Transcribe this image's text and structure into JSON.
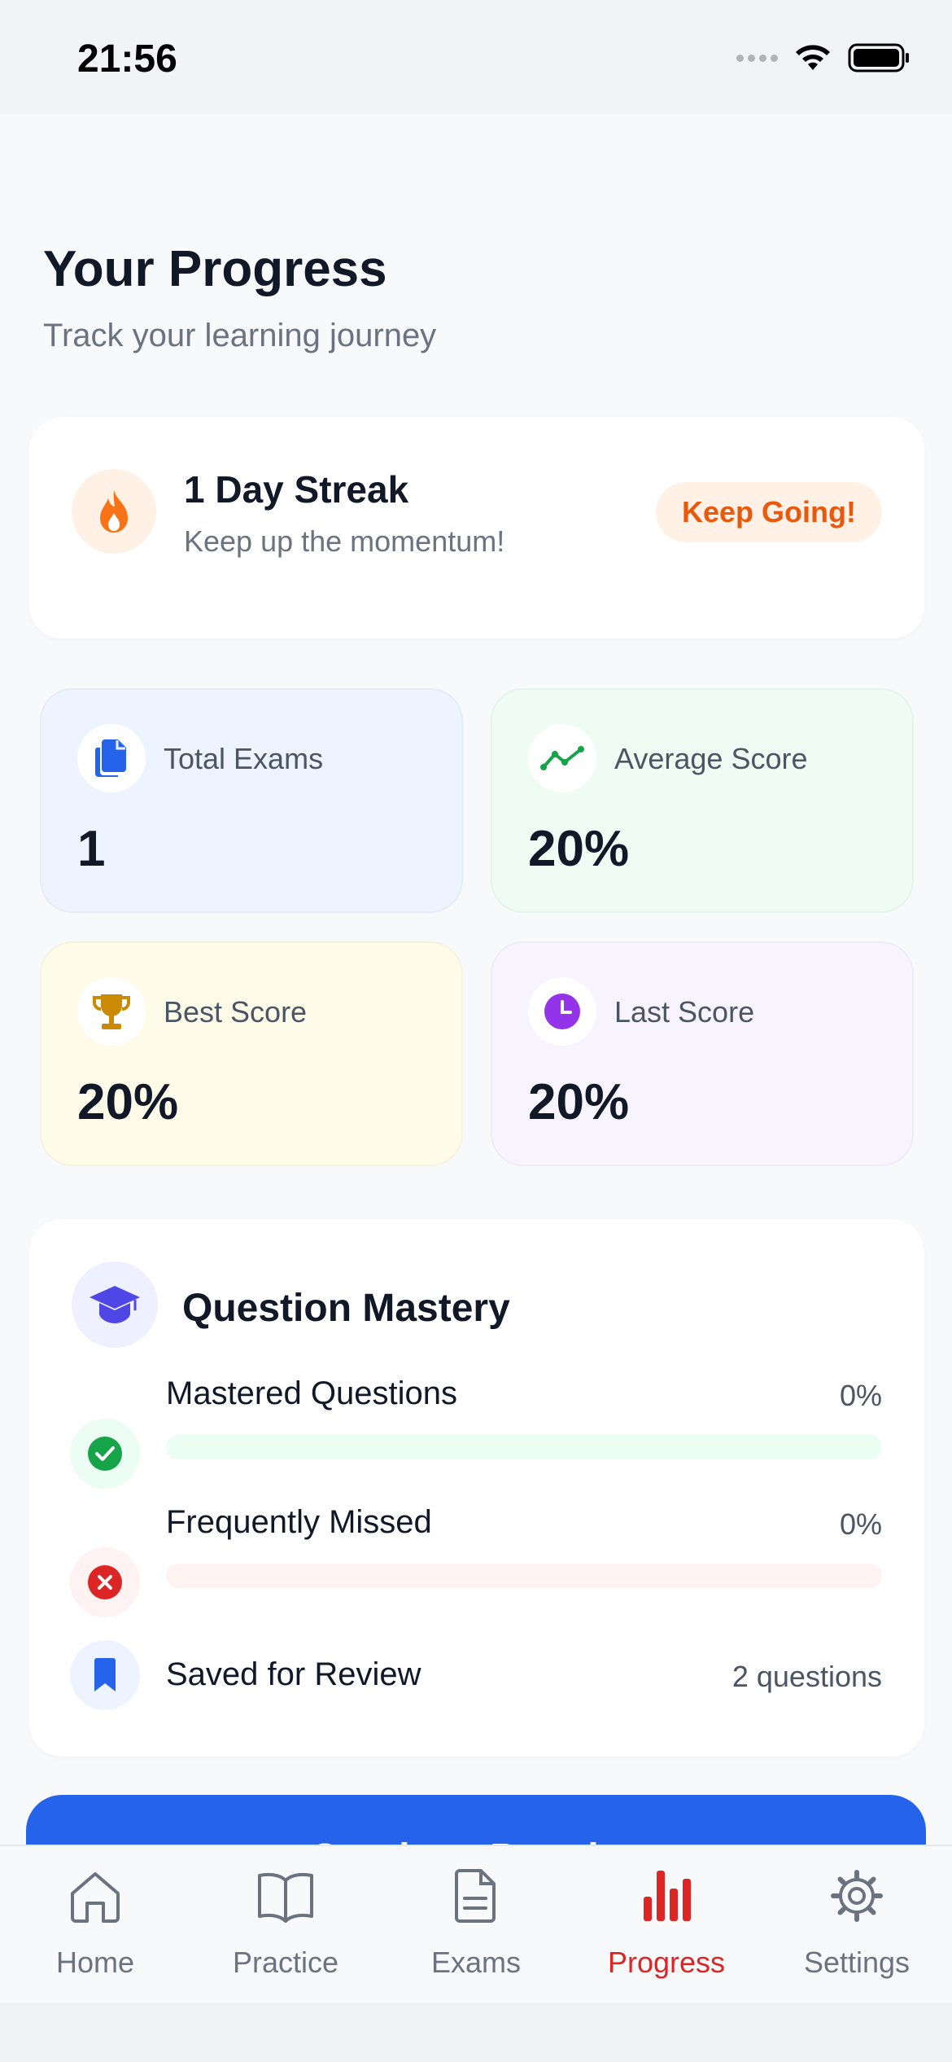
{
  "status_bar": {
    "time": "21:56"
  },
  "header": {
    "title": "Your Progress",
    "subtitle": "Track your learning journey"
  },
  "streak": {
    "icon": "flame-icon",
    "title": "1 Day Streak",
    "subtitle": "Keep up the momentum!",
    "badge": "Keep Going!"
  },
  "stats": {
    "total_exams": {
      "label": "Total Exams",
      "value": "1",
      "icon": "documents-icon"
    },
    "average_score": {
      "label": "Average Score",
      "value": "20%",
      "icon": "trend-icon"
    },
    "best_score": {
      "label": "Best Score",
      "value": "20%",
      "icon": "trophy-icon"
    },
    "last_score": {
      "label": "Last Score",
      "value": "20%",
      "icon": "clock-icon"
    }
  },
  "mastery": {
    "title": "Question Mastery",
    "mastered": {
      "label": "Mastered Questions",
      "value": "0%",
      "progress": 0
    },
    "missed": {
      "label": "Frequently Missed",
      "value": "0%",
      "progress": 0
    },
    "saved": {
      "label": "Saved for Review",
      "value": "2 questions"
    }
  },
  "cta": {
    "label": "Continue Practice"
  },
  "tabs": [
    {
      "label": "Home",
      "icon": "home-icon"
    },
    {
      "label": "Practice",
      "icon": "book-icon"
    },
    {
      "label": "Exams",
      "icon": "document-icon"
    },
    {
      "label": "Progress",
      "icon": "bar-chart-icon",
      "active": true
    },
    {
      "label": "Settings",
      "icon": "gear-icon"
    }
  ],
  "colors": {
    "accent": "#2563eb",
    "active_tab": "#dc2626",
    "streak": "#f97316",
    "success": "#16a34a",
    "danger": "#dc2626"
  }
}
